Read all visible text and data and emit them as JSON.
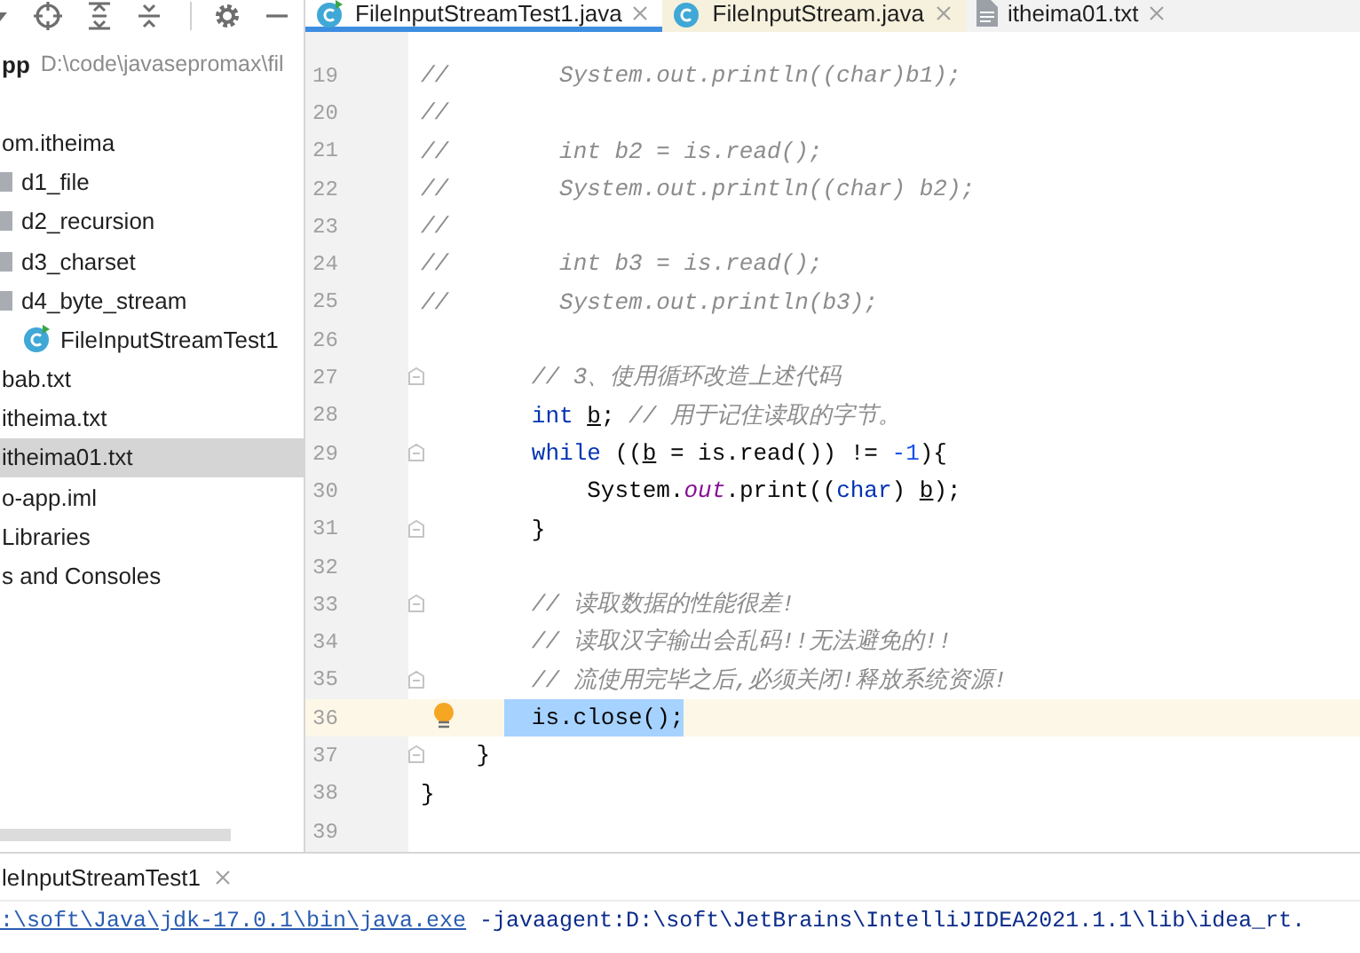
{
  "project_header": {
    "name": "pp",
    "path": "D:\\code\\javasepromax\\fil"
  },
  "project_tree": [
    {
      "label": "om.itheima",
      "selected": false,
      "children": [
        {
          "label": "d1_file",
          "kind": "folder",
          "selected": false
        },
        {
          "label": "d2_recursion",
          "kind": "folder",
          "selected": false
        },
        {
          "label": "d3_charset",
          "kind": "folder",
          "selected": false
        },
        {
          "label": "d4_byte_stream",
          "kind": "folder",
          "selected": false,
          "children": [
            {
              "label": "FileInputStreamTest1",
              "kind": "class",
              "selected": false
            }
          ]
        }
      ]
    },
    {
      "label": "bab.txt",
      "selected": false
    },
    {
      "label": "itheima.txt",
      "selected": false
    },
    {
      "label": "itheima01.txt",
      "selected": true
    },
    {
      "label": "o-app.iml",
      "selected": false
    },
    {
      "label": "Libraries",
      "selected": false
    },
    {
      "label": "s and Consoles",
      "selected": false
    }
  ],
  "editor_tabs": [
    {
      "label": "FileInputStreamTest1.java",
      "kind": "class",
      "selected": true,
      "external": false
    },
    {
      "label": "FileInputStream.java",
      "kind": "class",
      "selected": false,
      "external": true
    },
    {
      "label": "itheima01.txt",
      "kind": "text",
      "selected": false,
      "external": false
    }
  ],
  "code_lines": [
    {
      "number": "19",
      "fold": false,
      "current": false,
      "bulb": false,
      "tokens": [
        {
          "kind": "comment",
          "text": "//        System.out.println((char)b1);"
        }
      ]
    },
    {
      "number": "20",
      "fold": false,
      "current": false,
      "bulb": false,
      "tokens": [
        {
          "kind": "comment",
          "text": "//"
        }
      ]
    },
    {
      "number": "21",
      "fold": false,
      "current": false,
      "bulb": false,
      "tokens": [
        {
          "kind": "comment",
          "text": "//        int b2 = is.read();"
        }
      ]
    },
    {
      "number": "22",
      "fold": false,
      "current": false,
      "bulb": false,
      "tokens": [
        {
          "kind": "comment",
          "text": "//        System.out.println((char) b2);"
        }
      ]
    },
    {
      "number": "23",
      "fold": false,
      "current": false,
      "bulb": false,
      "tokens": [
        {
          "kind": "comment",
          "text": "//"
        }
      ]
    },
    {
      "number": "24",
      "fold": false,
      "current": false,
      "bulb": false,
      "tokens": [
        {
          "kind": "comment",
          "text": "//        int b3 = is.read();"
        }
      ]
    },
    {
      "number": "25",
      "fold": false,
      "current": false,
      "bulb": false,
      "tokens": [
        {
          "kind": "comment",
          "text": "//        System.out.println(b3);"
        }
      ]
    },
    {
      "number": "26",
      "fold": false,
      "current": false,
      "bulb": false
    },
    {
      "number": "27",
      "fold": true,
      "current": false,
      "bulb": false,
      "tokens": [
        {
          "kind": "comment",
          "text": "        // 3、使用循环改造上述代码"
        }
      ]
    },
    {
      "number": "28",
      "fold": false,
      "current": false,
      "bulb": false,
      "tokens": [
        {
          "kind": "keyword",
          "text": "        int "
        },
        {
          "kind": "variable",
          "text": "b"
        },
        {
          "kind": "plain",
          "text": "; "
        },
        {
          "kind": "comment",
          "text": "// 用于记住读取的字节。"
        }
      ]
    },
    {
      "number": "29",
      "fold": true,
      "current": false,
      "bulb": false,
      "tokens": [
        {
          "kind": "keyword",
          "text": "        while"
        },
        {
          "kind": "plain",
          "text": " (("
        },
        {
          "kind": "variable",
          "text": "b"
        },
        {
          "kind": "plain",
          "text": " = is.read()) != "
        },
        {
          "kind": "number",
          "text": "-1"
        },
        {
          "kind": "plain",
          "text": "){"
        }
      ]
    },
    {
      "number": "30",
      "fold": false,
      "current": false,
      "bulb": false,
      "tokens": [
        {
          "kind": "plain",
          "text": "            System."
        },
        {
          "kind": "field",
          "text": "out"
        },
        {
          "kind": "plain",
          "text": ".print(("
        },
        {
          "kind": "keyword",
          "text": "char"
        },
        {
          "kind": "plain",
          "text": ") "
        },
        {
          "kind": "variable",
          "text": "b"
        },
        {
          "kind": "plain",
          "text": ");"
        }
      ]
    },
    {
      "number": "31",
      "fold": true,
      "current": false,
      "bulb": false,
      "tokens": [
        {
          "kind": "plain",
          "text": "        }"
        }
      ]
    },
    {
      "number": "32",
      "fold": false,
      "current": false,
      "bulb": false
    },
    {
      "number": "33",
      "fold": true,
      "current": false,
      "bulb": false,
      "tokens": [
        {
          "kind": "comment",
          "text": "        // 读取数据的性能很差!"
        }
      ]
    },
    {
      "number": "34",
      "fold": false,
      "current": false,
      "bulb": false,
      "tokens": [
        {
          "kind": "comment",
          "text": "        // 读取汉字输出会乱码!!无法避免的!!"
        }
      ]
    },
    {
      "number": "35",
      "fold": true,
      "current": false,
      "bulb": false,
      "tokens": [
        {
          "kind": "comment",
          "text": "        // 流使用完毕之后,必须关闭!释放系统资源!"
        }
      ]
    },
    {
      "number": "36",
      "fold": false,
      "current": true,
      "bulb": true,
      "tokens": [
        {
          "kind": "selection",
          "text": "is.close();"
        }
      ]
    },
    {
      "number": "37",
      "fold": true,
      "current": false,
      "bulb": false,
      "tokens": [
        {
          "kind": "plain",
          "text": "    }"
        }
      ]
    },
    {
      "number": "38",
      "fold": false,
      "current": false,
      "bulb": false,
      "tokens": [
        {
          "kind": "plain",
          "text": "}"
        }
      ]
    },
    {
      "number": "39",
      "fold": false,
      "current": false,
      "bulb": false
    }
  ],
  "run_panel": {
    "tab": "leInputStreamTest1",
    "console_link": ":\\soft\\Java\\jdk-17.0.1\\bin\\java.exe",
    "console_text": " -javaagent:D:\\soft\\JetBrains\\IntelliJIDEA2021.1.1\\lib\\idea_rt."
  }
}
